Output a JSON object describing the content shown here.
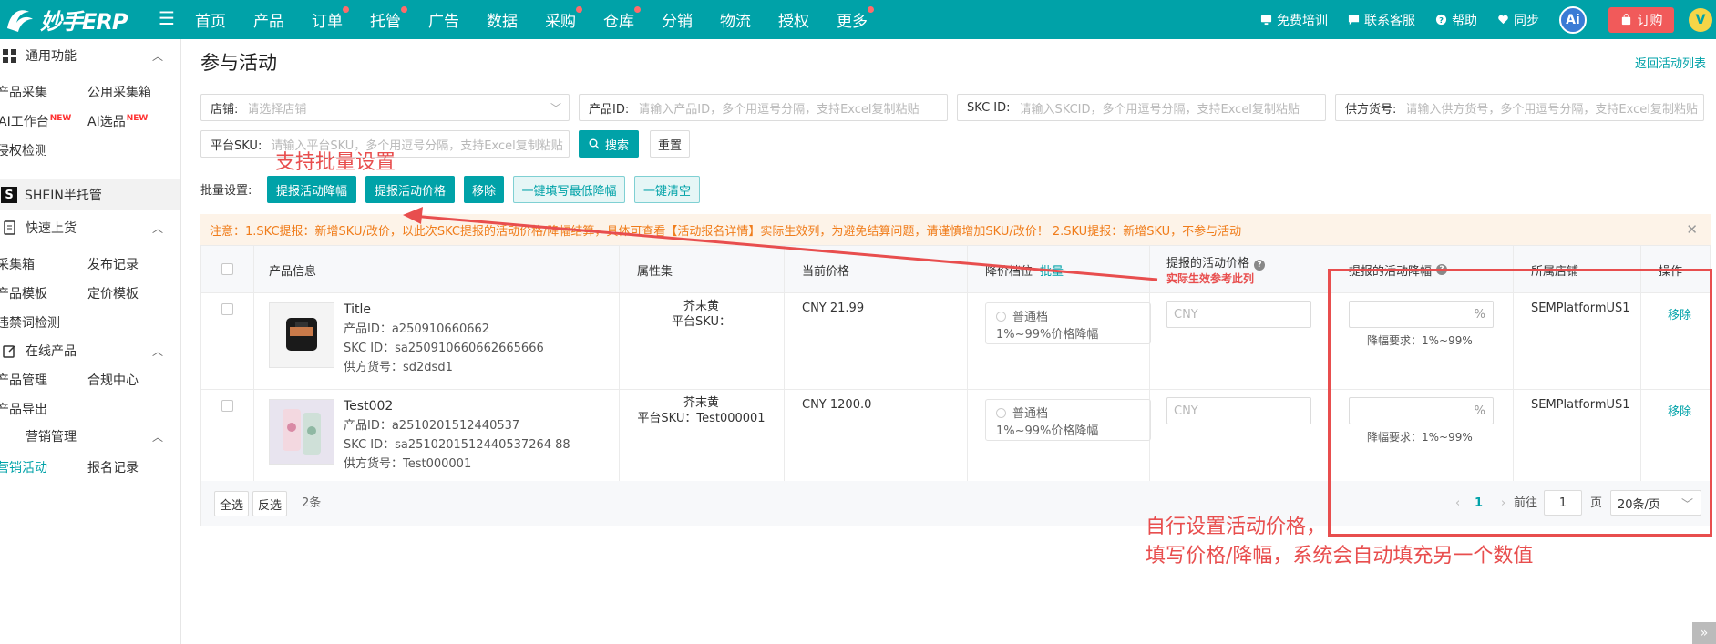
{
  "app": {
    "logo_text": "妙手ERP"
  },
  "topnav": {
    "items": [
      {
        "label": "首页",
        "dot": false
      },
      {
        "label": "产品",
        "dot": false
      },
      {
        "label": "订单",
        "dot": true
      },
      {
        "label": "托管",
        "dot": true
      },
      {
        "label": "广告",
        "dot": false
      },
      {
        "label": "数据",
        "dot": false
      },
      {
        "label": "采购",
        "dot": true
      },
      {
        "label": "仓库",
        "dot": true
      },
      {
        "label": "分销",
        "dot": false
      },
      {
        "label": "物流",
        "dot": false
      },
      {
        "label": "授权",
        "dot": false
      },
      {
        "label": "更多",
        "dot": true
      }
    ]
  },
  "topright": {
    "training": "免费培训",
    "support": "联系客服",
    "help": "帮助",
    "sync": "同步",
    "ai": "Ai",
    "order": "订购",
    "avatar": "V"
  },
  "sidebar": {
    "group_general": "通用功能",
    "product_collect": "产品采集",
    "public_box": "公用采集箱",
    "ai_workbench": "AI工作台",
    "ai_select": "AI选品",
    "new_badge": "NEW",
    "infringe_check": "侵权检测",
    "shein": "SHEIN半托管",
    "shein_icon": "S",
    "group_quick": "快速上货",
    "collect_box": "采集箱",
    "publish_log": "发布记录",
    "product_template": "产品模板",
    "price_template": "定价模板",
    "banned_words": "违禁词检测",
    "group_online": "在线产品",
    "product_manage": "产品管理",
    "compliance": "合规中心",
    "product_export": "产品导出",
    "group_marketing": "营销管理",
    "marketing_activity": "营销活动",
    "signup_log": "报名记录"
  },
  "page": {
    "title": "参与活动",
    "back_link": "返回活动列表"
  },
  "filters": {
    "store_label": "店铺:",
    "store_placeholder": "请选择店铺",
    "pid_label": "产品ID:",
    "pid_placeholder": "请输入产品ID，多个用逗号分隔，支持Excel复制粘贴",
    "skc_label": "SKC ID:",
    "skc_placeholder": "请输入SKCID，多个用逗号分隔，支持Excel复制粘贴",
    "supplier_label": "供方货号:",
    "supplier_placeholder": "请输入供方货号，多个用逗号分隔，支持Excel复制粘贴",
    "sku_label": "平台SKU:",
    "sku_placeholder": "请输入平台SKU，多个用逗号分隔，支持Excel复制粘贴",
    "search": "搜索",
    "reset": "重置"
  },
  "batch": {
    "label": "批量设置:",
    "set_discount": "提报活动降幅",
    "set_price": "提报活动价格",
    "remove": "移除",
    "fill_min": "一键填写最低降幅",
    "clear": "一键清空"
  },
  "notice": {
    "text": "注意：1.SKC提报：新增SKU/改价，以此次SKC提报的活动价格/降幅结算，具体可查看【活动报名详情】实际生效列，为避免结算问题，请谨慎增加SKU/改价！ 2.SKU提报：新增SKU，不参与活动"
  },
  "table": {
    "headers": {
      "product_info": "产品信息",
      "attributes": "属性集",
      "current_price": "当前价格",
      "tier": "降价档位",
      "tier_batch": "批量",
      "activity_price": "提报的活动价格",
      "activity_price_note": "实际生效参考此列",
      "activity_discount": "提报的活动降幅",
      "store": "所属店铺",
      "action": "操作"
    },
    "rows": [
      {
        "title": "Title",
        "pid": "产品ID：a250910660662",
        "skc": "SKC ID：sa250910660662665666",
        "supplier": "供方货号：sd2dsd1",
        "attr_color": "芥末黄",
        "attr_sku": "平台SKU：",
        "price": "CNY 21.99",
        "tier_name": "普通档",
        "tier_range": "1%~99%价格降幅",
        "price_placeholder": "CNY",
        "pct": "%",
        "discount_req": "降幅要求：1%~99%",
        "store": "SEMPlatformUS1",
        "action": "移除"
      },
      {
        "title": "Test002",
        "pid": "产品ID：a2510201512440537",
        "skc": "SKC ID：sa2510201512440537264 88",
        "supplier": "供方货号：Test000001",
        "attr_color": "芥末黄",
        "attr_sku": "平台SKU：Test000001",
        "price": "CNY 1200.0",
        "tier_name": "普通档",
        "tier_range": "1%~99%价格降幅",
        "price_placeholder": "CNY",
        "pct": "%",
        "discount_req": "降幅要求：1%~99%",
        "store": "SEMPlatformUS1",
        "action": "移除"
      }
    ]
  },
  "footer": {
    "select_all": "全选",
    "invert": "反选",
    "count": "2条",
    "prev": "‹",
    "page": "1",
    "next": "›",
    "goto": "前往",
    "goto_value": "1",
    "page_unit": "页",
    "page_size": "20条/页"
  },
  "annotations": {
    "batch_note": "支持批量设置",
    "custom_line1": "自行设置活动价格，",
    "custom_line2": "填写价格/降幅，系统会自动填充另一个数值",
    "color": "#e84e4e"
  },
  "corner": "»"
}
